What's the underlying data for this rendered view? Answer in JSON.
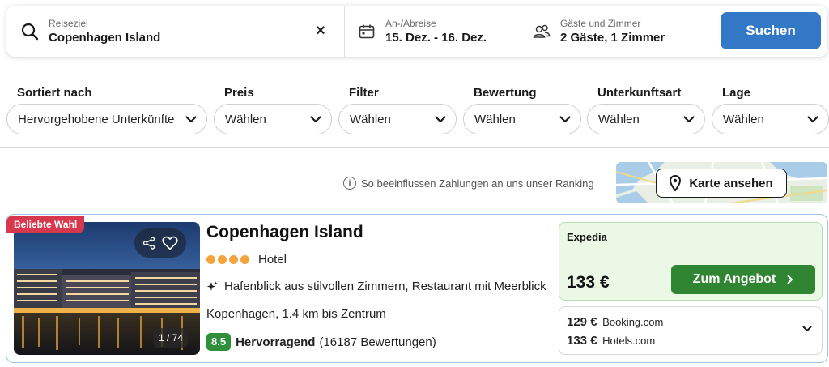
{
  "search": {
    "destination_label": "Reiseziel",
    "destination_value": "Copenhagen Island",
    "clear_icon": "×",
    "dates_label": "An-/Abreise",
    "dates_value": "15. Dez. - 16. Dez.",
    "guests_label": "Gäste und Zimmer",
    "guests_value": "2 Gäste, 1 Zimmer",
    "search_button": "Suchen"
  },
  "filters": [
    {
      "label": "Sortiert nach",
      "value": "Hervorgehobene Unterkünfte"
    },
    {
      "label": "Preis",
      "value": "Wählen"
    },
    {
      "label": "Filter",
      "value": "Wählen"
    },
    {
      "label": "Bewertung",
      "value": "Wählen"
    },
    {
      "label": "Unterkunftsart",
      "value": "Wählen"
    },
    {
      "label": "Lage",
      "value": "Wählen"
    }
  ],
  "ranking_info": {
    "icon": "i",
    "text": "So beeinflussen Zahlungen an uns unser Ranking"
  },
  "map": {
    "button_label": "Karte ansehen"
  },
  "hotel": {
    "badge": "Beliebte Wahl",
    "photo_count": "1 / 74",
    "name": "Copenhagen Island",
    "star_count": 4,
    "type": "Hotel",
    "highlight": "Hafenblick aus stilvollen Zimmern, Restaurant mit Meerblick",
    "location": "Kopenhagen, 1.4 km bis Zentrum",
    "score": "8.5",
    "rating_word": "Hervorragend",
    "reviews": "(16187 Bewertungen)",
    "best_offer": {
      "provider": "Expedia",
      "price": "133 €",
      "button": "Zum Angebot"
    },
    "other_offers": [
      {
        "price": "129 €",
        "provider": "Booking.com"
      },
      {
        "price": "133 €",
        "provider": "Hotels.com"
      }
    ]
  },
  "colors": {
    "primary": "#3378c7",
    "deal_green": "#2f8531",
    "badge_red": "#d7384e",
    "score_green": "#2f8f3a",
    "star_orange": "#f5a33c"
  }
}
